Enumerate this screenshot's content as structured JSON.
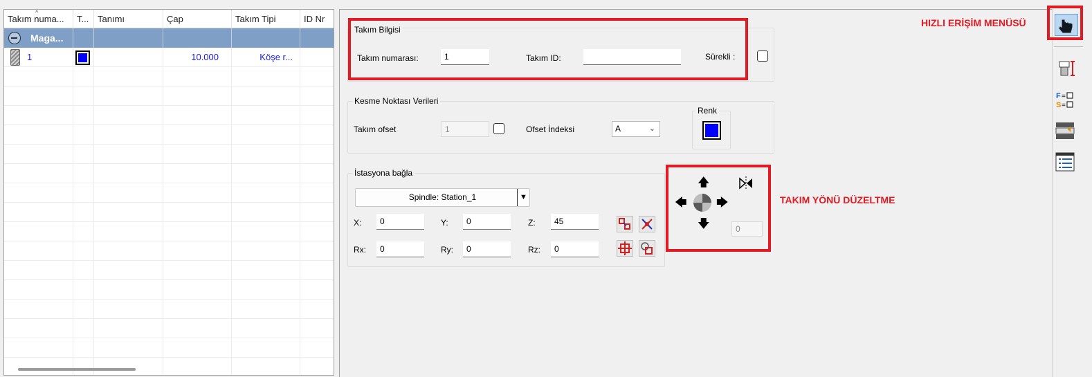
{
  "table": {
    "columns": [
      "Takım numa...",
      "T...",
      "Tanımı",
      "Çap",
      "Takım Tipi",
      "ID Nr"
    ],
    "group_label": "Maga...",
    "rows": [
      {
        "number": "1",
        "description": "",
        "diameter": "10.000",
        "type": "Köşe r...",
        "id": ""
      }
    ]
  },
  "tool_info": {
    "title": "Takım Bilgisi",
    "number_label": "Takım numarası:",
    "number_value": "1",
    "id_label": "Takım ID:",
    "id_value": "",
    "continuous_label": "Sürekli :"
  },
  "cut_point": {
    "title": "Kesme Noktası Verileri",
    "offset_label": "Takım ofset",
    "offset_value": "1",
    "offset_index_label": "Ofset İndeksi",
    "offset_index_value": "A",
    "color_label": "Renk",
    "color": "#0000ff"
  },
  "station": {
    "title": "İstasyona bağla",
    "spindle_value": "Spindle: Station_1",
    "x_label": "X:",
    "x_value": "0",
    "y_label": "Y:",
    "y_value": "0",
    "z_label": "Z:",
    "z_value": "45",
    "rx_label": "Rx:",
    "rx_value": "0",
    "ry_label": "Ry:",
    "ry_value": "0",
    "rz_label": "Rz:",
    "rz_value": "0"
  },
  "orientation": {
    "angle_value": "0"
  },
  "annotations": {
    "quick_access": "HIZLI ERİŞİM MENÜSÜ",
    "tool_direction": "TAKIM YÖNÜ DÜZELTME"
  },
  "sidebar_icons": [
    "hand-pointer-icon",
    "tool-dimension-icon",
    "feed-speed-icon",
    "tool-library-icon",
    "list-settings-icon"
  ],
  "colors": {
    "accent_red": "#e21a23",
    "group_row": "#7f9fc7",
    "link_blue": "#1a1ae6"
  }
}
